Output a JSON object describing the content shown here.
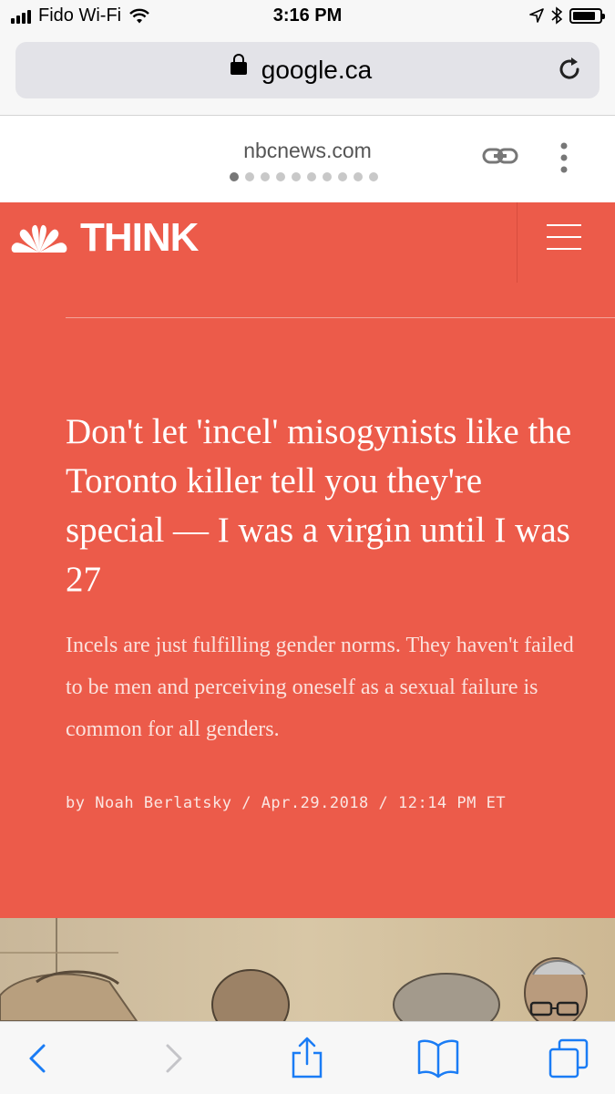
{
  "status_bar": {
    "carrier": "Fido Wi-Fi",
    "time": "3:16 PM",
    "battery_level": 0.9
  },
  "browser": {
    "address": "google.ca",
    "tab_site": "nbcnews.com",
    "page_dots": 10,
    "active_dot": 0
  },
  "article": {
    "brand": "THINK",
    "headline": "Don't let 'incel' misogynists like the Toronto killer tell you they're special — I was a virgin until I was 27",
    "dek": "Incels are just fulfilling gender norms. They haven't failed to be men and perceiving oneself as a sexual failure is common for all genders.",
    "byline": "by Noah Berlatsky / Apr.29.2018 / 12:14 PM ET"
  },
  "colors": {
    "accent": "#ec5b4a",
    "ios_blue": "#1a7cf5"
  },
  "icons": {
    "back": "chevron-left-icon",
    "forward": "chevron-right-icon",
    "share": "share-icon",
    "bookmarks": "book-icon",
    "tabs": "tabs-icon",
    "reload": "reload-icon",
    "link": "link-icon",
    "more": "more-vertical-icon",
    "lock": "lock-icon",
    "logo": "peacock-logo"
  }
}
